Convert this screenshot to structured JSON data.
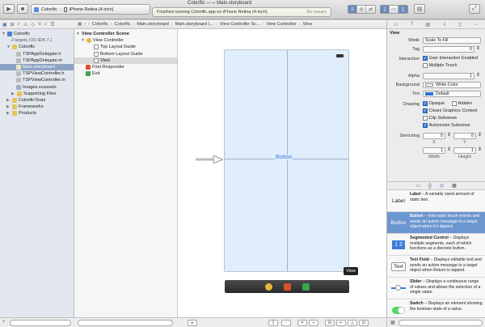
{
  "window": {
    "title": "Colorific — ⌐ Main.storyboard"
  },
  "toolbar": {
    "scheme_target": "Colorific",
    "scheme_device": "iPhone Retina (4-inch)",
    "status_message": "Finished running Colorific.app on iPhone Retina (4-inch)",
    "issues": "No Issues"
  },
  "navigator": {
    "items": [
      {
        "label": "Colorific",
        "sub": "2 targets, iOS SDK 7.1"
      },
      {
        "label": "Colorific"
      },
      {
        "label": "TSPAppDelegate.h"
      },
      {
        "label": "TSPAppDelegate.m"
      },
      {
        "label": "Main.storyboard"
      },
      {
        "label": "TSPViewController.h"
      },
      {
        "label": "TSPViewController.m"
      },
      {
        "label": "Images.xcassets"
      },
      {
        "label": "Supporting Files"
      },
      {
        "label": "ColorificTests"
      },
      {
        "label": "Frameworks"
      },
      {
        "label": "Products"
      }
    ]
  },
  "jumpbar": {
    "items": [
      "Colorific",
      "Colorific",
      "Main.storyboard",
      "Main.storyboard (...",
      "View Controller Sc...",
      "View Controller",
      "View"
    ]
  },
  "outline": {
    "items": [
      "View Controller Scene",
      "View Controller",
      "Top Layout Guide",
      "Bottom Layout Guide",
      "View",
      "First Responder",
      "Exit"
    ]
  },
  "canvas": {
    "button_label": "Button",
    "view_tag": "View"
  },
  "inspector": {
    "section": "View",
    "mode_label": "Mode",
    "mode_value": "Scale To Fill",
    "tag_label": "Tag",
    "tag_value": "0",
    "interaction_label": "Interaction",
    "user_interaction": "User Interaction Enabled",
    "multiple_touch": "Multiple Touch",
    "alpha_label": "Alpha",
    "alpha_value": "1",
    "background_label": "Background",
    "background_value": "White Color",
    "tint_label": "Tint",
    "tint_value": "Default",
    "drawing_label": "Drawing",
    "opaque": "Opaque",
    "hidden": "Hidden",
    "clears": "Clears Graphics Context",
    "clip": "Clip Subviews",
    "autoresize": "Autoresize Subviews",
    "stretching_label": "Stretching",
    "x_value": "0",
    "y_value": "0",
    "x_label": "X",
    "y_label": "Y",
    "w_value": "1",
    "h_value": "1",
    "width_label": "Width",
    "height_label": "Height"
  },
  "library": {
    "items": [
      {
        "icon": "Label",
        "name": "Label",
        "desc": " – A variably sized amount of static text."
      },
      {
        "icon": "Button",
        "name": "Button",
        "desc": " – Intercepts touch events and sends an action message to a target object when it's tapped."
      },
      {
        "icon": "1 2",
        "name": "Segmented Control",
        "desc": " – Displays multiple segments, each of which functions as a discrete button."
      },
      {
        "icon": "Text",
        "name": "Text Field",
        "desc": " – Displays editable text and sends an action message to a target object when Return is tapped."
      },
      {
        "icon": "slider",
        "name": "Slider",
        "desc": " – Displays a continuous range of values and allows the selection of a single value."
      },
      {
        "icon": "switch",
        "name": "Switch",
        "desc": " – Displays an element showing the boolean state of a value."
      }
    ]
  },
  "colors": {
    "selection": "#8da3c3",
    "accent": "#3d7dd8",
    "canvas_view": "#e0eefc"
  }
}
